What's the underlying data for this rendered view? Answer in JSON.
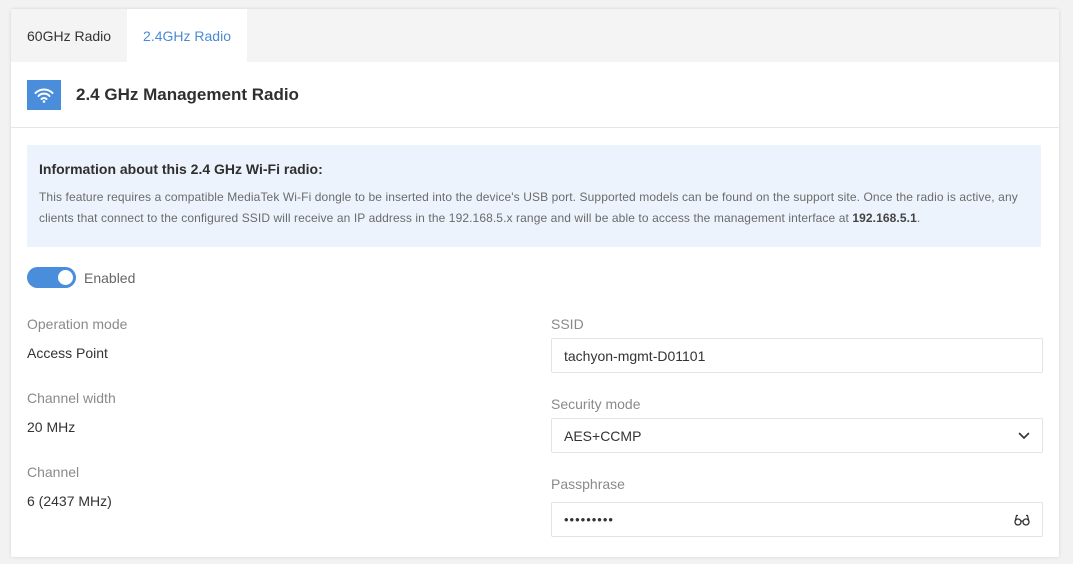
{
  "tabs": [
    {
      "label": "60GHz Radio",
      "active": false
    },
    {
      "label": "2.4GHz Radio",
      "active": true
    }
  ],
  "header": {
    "icon": "wifi-icon",
    "title": "2.4 GHz Management Radio"
  },
  "info": {
    "title": "Information about this 2.4 GHz Wi-Fi radio:",
    "text_part1": "This feature requires a compatible MediaTek Wi-Fi dongle to be inserted into the device's USB port. Supported models can be found on the support site. Once the radio is active, any clients that connect to the configured SSID will receive an IP address in the 192.168.5.x range and will be able to access the management interface at ",
    "text_ip": "192.168.5.1",
    "text_end": "."
  },
  "enabled": {
    "label": "Enabled",
    "value": true
  },
  "fields": {
    "operation_mode": {
      "label": "Operation mode",
      "value": "Access Point"
    },
    "channel_width": {
      "label": "Channel width",
      "value": "20 MHz"
    },
    "channel": {
      "label": "Channel",
      "value": "6 (2437 MHz)"
    },
    "ssid": {
      "label": "SSID",
      "value": "tachyon-mgmt-D01101"
    },
    "security_mode": {
      "label": "Security mode",
      "value": "AES+CCMP",
      "icon": "chevron-down-icon"
    },
    "passphrase": {
      "label": "Passphrase",
      "value": "•••••••••",
      "icon": "glasses-icon"
    }
  },
  "colors": {
    "accent": "#4a8ddb",
    "tab_active_text": "#4a8bd6",
    "info_bg": "#edf3fc"
  }
}
